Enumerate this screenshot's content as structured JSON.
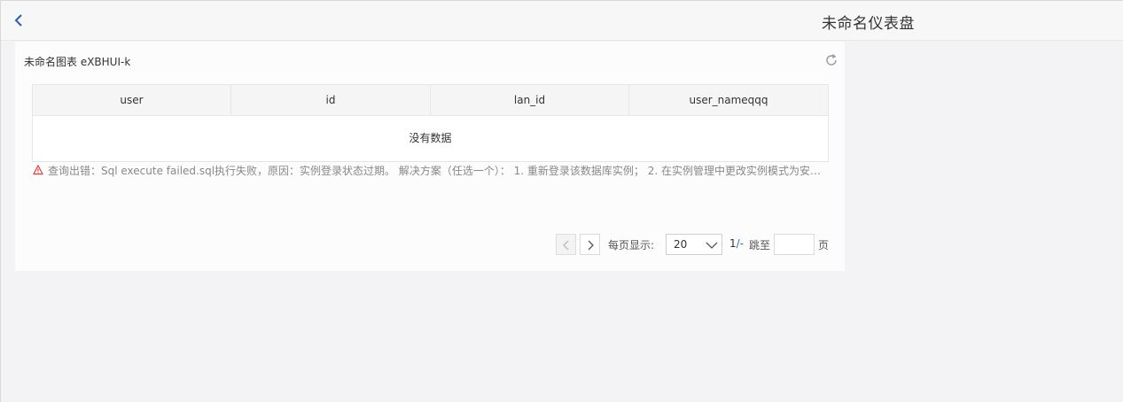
{
  "header": {
    "title": "未命名仪表盘",
    "back_icon": "chevron-left-icon",
    "accent": "#2a5fb0"
  },
  "card": {
    "title": "未命名图表 eXBHUI-k",
    "refresh_icon": "refresh-icon",
    "table": {
      "columns": [
        "user",
        "id",
        "lan_id",
        "user_nameqqq"
      ],
      "empty_text": "没有数据"
    },
    "error": {
      "icon": "warning-triangle-icon",
      "color": "#e04040",
      "text": "查询出错：Sql execute failed.sql执行失败，原因：实例登录状态过期。 解决方案（任选一个）： 1. 重新登录该数据库实例； 2. 在实例管理中更改实例模式为安全协..."
    },
    "pagination": {
      "prev_icon": "chevron-left-icon",
      "next_icon": "chevron-right-icon",
      "per_page_label": "每页显示:",
      "per_page_value": "20",
      "page_current": "1",
      "page_sep": "/-",
      "jump_label": "跳至",
      "jump_value": "",
      "jump_suffix": "页"
    }
  }
}
